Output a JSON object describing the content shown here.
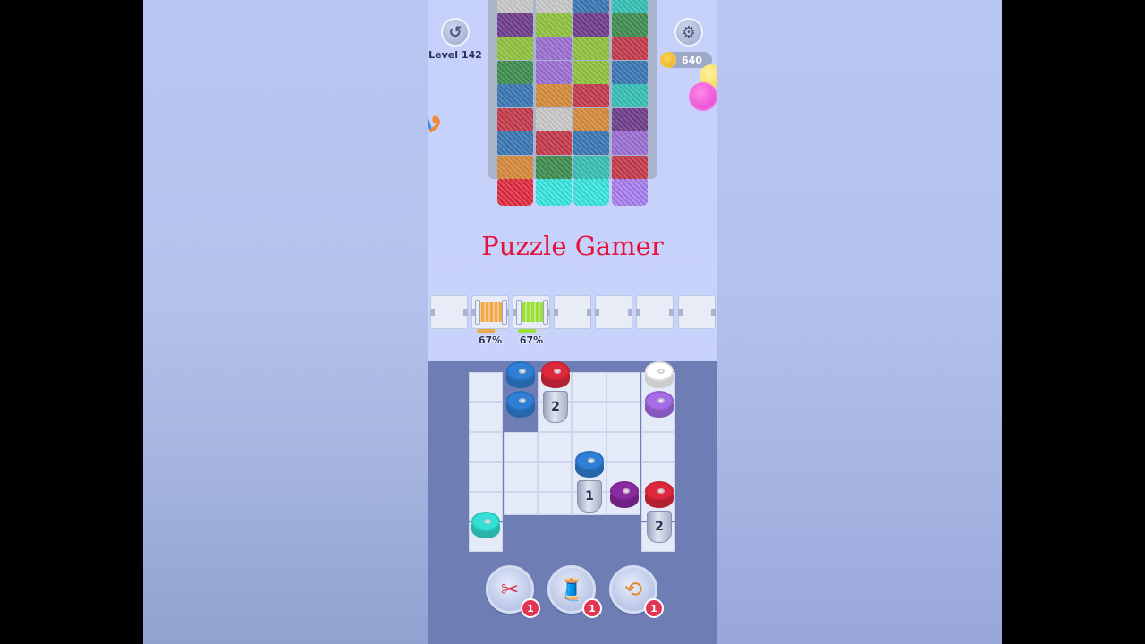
{
  "hud": {
    "level_label": "Level 142",
    "coins": "640",
    "undo_icon": "undo-icon",
    "settings_icon": "gear-icon"
  },
  "watermark": "Puzzle Gamer",
  "colors": {
    "grey": "#c8c8c8",
    "purple": "#6e3d8a",
    "teal": "#35bfb5",
    "green": "#3f8d4f",
    "lime": "#8fc23e",
    "lavender": "#9b6ed3",
    "blue": "#3a76b3",
    "red": "#c43a4a",
    "orange": "#d58b3a",
    "brightred": "#e0283c",
    "cyan": "#36e6e0",
    "violet": "#a87cf0"
  },
  "fabric": {
    "columns": [
      [
        "grey",
        "purple",
        "lime",
        "green",
        "blue",
        "red",
        "blue",
        "orange"
      ],
      [
        "grey",
        "lime",
        "lavender",
        "lavender",
        "orange",
        "grey",
        "red",
        "green"
      ],
      [
        "blue",
        "purple",
        "lime",
        "lime",
        "red",
        "orange",
        "blue",
        "teal"
      ],
      [
        "teal",
        "green",
        "red",
        "blue",
        "teal",
        "purple",
        "lavender",
        "red"
      ]
    ],
    "tails": [
      "brightred",
      "cyan",
      "cyan",
      "violet"
    ]
  },
  "holder": {
    "slots": [
      {
        "spool": null
      },
      {
        "spool": "#f0a94a",
        "progress": 0.67,
        "label": "67%"
      },
      {
        "spool": "#9be03a",
        "progress": 0.67,
        "label": "67%"
      },
      {
        "spool": null
      },
      {
        "spool": null
      },
      {
        "spool": null
      },
      {
        "spool": null
      }
    ]
  },
  "board": {
    "stacks": [
      {
        "discs": [
          "#2f7fd6",
          "#2f7fd6"
        ]
      },
      {
        "discs": [
          "#e0283c"
        ],
        "cylinder": "2"
      },
      {
        "discs": [
          "#ffffff",
          "#a66de8"
        ]
      },
      {
        "discs": [
          "#2f7fd6"
        ],
        "cylinder": "1"
      },
      {
        "discs": [
          "#8a2aa0"
        ]
      },
      {
        "discs": [
          "#e0283c"
        ],
        "cylinder": "2"
      },
      {
        "discs": [
          "#34e0d6"
        ]
      }
    ]
  },
  "boosters": [
    {
      "icon": "scissors-icon",
      "count": "1"
    },
    {
      "icon": "thread-spool-icon",
      "count": "1"
    },
    {
      "icon": "swap-icon",
      "count": "1"
    }
  ]
}
